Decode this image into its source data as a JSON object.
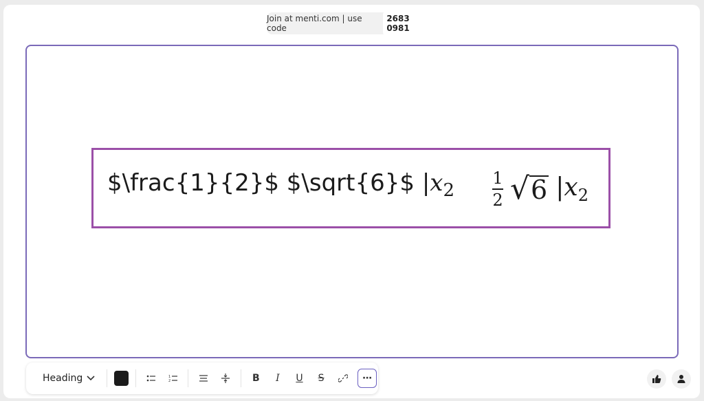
{
  "join": {
    "prefix": "Join at menti.com | use code",
    "code": "2683 0981"
  },
  "slide": {
    "raw_before": "$\\frac{1}{2}$ $\\sqrt{6}$ |",
    "raw_var": "x",
    "raw_sub": "2",
    "rendered": {
      "frac_num": "1",
      "frac_den": "2",
      "sqrt_radicand": "6",
      "abs_bar": "|",
      "var": "x",
      "sub": "2"
    }
  },
  "toolbar": {
    "heading_label": "Heading",
    "text_color": "#1b1b1b",
    "bold_label": "B",
    "italic_label": "I",
    "underline_label": "U",
    "strike_label": "S",
    "more_label": "⋯"
  },
  "icons": [
    "chevron-down-icon",
    "bullet-list-icon",
    "numbered-list-icon",
    "align-icon",
    "line-spacing-icon",
    "link-icon",
    "more-icon",
    "thumbs-up-icon",
    "person-icon"
  ]
}
